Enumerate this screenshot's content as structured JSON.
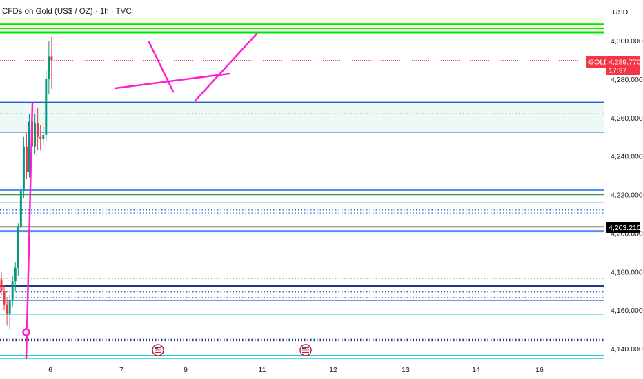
{
  "header": {
    "symbol_title": "CFDs on Gold (US$ / OZ) · 1h · TVC",
    "currency": "USD"
  },
  "price_tags": {
    "last_symbol": "GOLD",
    "last_price": "4,289.770",
    "countdown": "17:37",
    "marker_price": "4,203.210",
    "last_color": "#f23645",
    "marker_color": "#000000"
  },
  "chart_data": {
    "type": "candlestick",
    "title": "CFDs on Gold (US$ / OZ) · 1h · TVC",
    "x_ticks": [
      "6",
      "7",
      "9",
      "11",
      "12",
      "13",
      "14",
      "16"
    ],
    "y_ticks": [
      "4,140.000",
      "4,160.000",
      "4,180.000",
      "4,200.000",
      "4,220.000",
      "4,240.000",
      "4,260.000",
      "4,280.000",
      "4,300.000"
    ],
    "ylim": [
      4134,
      4312
    ],
    "last_price": 4289.77,
    "candles": [
      {
        "o": 4176,
        "h": 4180,
        "l": 4168,
        "c": 4170
      },
      {
        "o": 4170,
        "h": 4173,
        "l": 4160,
        "c": 4163
      },
      {
        "o": 4163,
        "h": 4166,
        "l": 4152,
        "c": 4158
      },
      {
        "o": 4158,
        "h": 4168,
        "l": 4150,
        "c": 4165
      },
      {
        "o": 4165,
        "h": 4178,
        "l": 4162,
        "c": 4175
      },
      {
        "o": 4175,
        "h": 4185,
        "l": 4170,
        "c": 4182
      },
      {
        "o": 4182,
        "h": 4205,
        "l": 4178,
        "c": 4203
      },
      {
        "o": 4203,
        "h": 4225,
        "l": 4200,
        "c": 4222
      },
      {
        "o": 4222,
        "h": 4250,
        "l": 4218,
        "c": 4245
      },
      {
        "o": 4245,
        "h": 4252,
        "l": 4228,
        "c": 4232
      },
      {
        "o": 4232,
        "h": 4262,
        "l": 4229,
        "c": 4258
      },
      {
        "o": 4258,
        "h": 4268,
        "l": 4240,
        "c": 4245
      },
      {
        "o": 4245,
        "h": 4262,
        "l": 4241,
        "c": 4257
      },
      {
        "o": 4257,
        "h": 4265,
        "l": 4243,
        "c": 4250
      },
      {
        "o": 4250,
        "h": 4256,
        "l": 4243,
        "c": 4249
      },
      {
        "o": 4249,
        "h": 4255,
        "l": 4246,
        "c": 4251
      },
      {
        "o": 4251,
        "h": 4285,
        "l": 4248,
        "c": 4280
      },
      {
        "o": 4280,
        "h": 4300,
        "l": 4272,
        "c": 4292
      },
      {
        "o": 4292,
        "h": 4302,
        "l": 4275,
        "c": 4289.77
      }
    ],
    "hlines": [
      {
        "y": 4308.5,
        "color": "#00e600",
        "width": 2,
        "dash": "solid"
      },
      {
        "y": 4306.5,
        "color": "#00e600",
        "width": 2,
        "dash": "solid"
      },
      {
        "y": 4304.3,
        "color": "#00e600",
        "width": 3,
        "dash": "solid"
      },
      {
        "y": 4268.0,
        "color": "#1e5ccf",
        "width": 1.5,
        "dash": "solid"
      },
      {
        "y": 4262.0,
        "color": "#26a69a",
        "width": 1.2,
        "dash": "dotted"
      },
      {
        "y": 4252.5,
        "color": "#1e5ccf",
        "width": 1.5,
        "dash": "solid"
      },
      {
        "y": 4222.5,
        "color": "#5b8def",
        "width": 3,
        "dash": "solid"
      },
      {
        "y": 4220.0,
        "color": "#2e9b3a",
        "width": 1.5,
        "dash": "solid"
      },
      {
        "y": 4215.8,
        "color": "#1e5ccf",
        "width": 1,
        "dash": "solid"
      },
      {
        "y": 4212.0,
        "color": "#1e5ccf",
        "width": 1.2,
        "dash": "dotted"
      },
      {
        "y": 4210.5,
        "color": "#1e5ccf",
        "width": 1.2,
        "dash": "dotted"
      },
      {
        "y": 4203.21,
        "color": "#000000",
        "width": 1.5,
        "dash": "solid"
      },
      {
        "y": 4201.0,
        "color": "#5b8def",
        "width": 3,
        "dash": "solid"
      },
      {
        "y": 4176.5,
        "color": "#26a69a",
        "width": 1.2,
        "dash": "dotted"
      },
      {
        "y": 4172.5,
        "color": "#1e3a8a",
        "width": 3,
        "dash": "solid"
      },
      {
        "y": 4169.5,
        "color": "#1e5ccf",
        "width": 1.5,
        "dash": "dotted"
      },
      {
        "y": 4166.5,
        "color": "#1e5ccf",
        "width": 1.5,
        "dash": "dotted"
      },
      {
        "y": 4165.0,
        "color": "#1e5ccf",
        "width": 1,
        "dash": "solid"
      },
      {
        "y": 4158.0,
        "color": "#26c6da",
        "width": 1.5,
        "dash": "solid"
      },
      {
        "y": 4144.5,
        "color": "#1e3a8a",
        "width": 3.5,
        "dash": "dotted"
      },
      {
        "y": 4136.5,
        "color": "#26c6da",
        "width": 1.5,
        "dash": "solid"
      },
      {
        "y": 4135.0,
        "color": "#26c6da",
        "width": 1.5,
        "dash": "solid"
      }
    ],
    "colors": {
      "up": "#089981",
      "down": "#f23645",
      "drawing": "#ff1fd1",
      "last_price_line": "#f23645",
      "zone_top": "#f3fbe3",
      "zone_mid": "#eef8f4"
    }
  }
}
